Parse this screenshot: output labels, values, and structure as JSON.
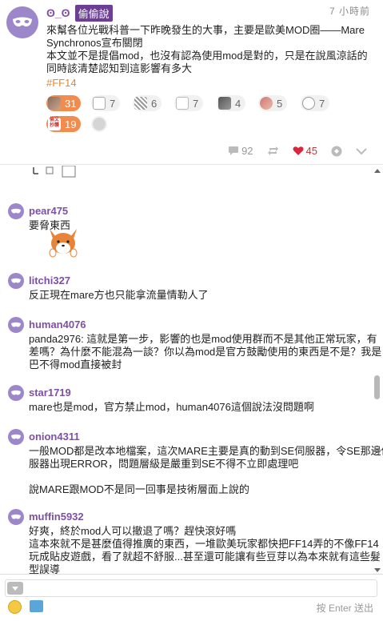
{
  "post": {
    "author_id": "ʘ_ʘ",
    "author_name": "偷偷說",
    "time": "7 小時前",
    "body_lines": [
      "來幫各位光戰科普一下昨晚發生的大事，主要是歐美MOD圈——Mare",
      "Synchronos宣布關閉",
      "本文並不是提倡mod，也沒有認為使用mod是對的，只是在說風涼話的",
      "同時該清楚認知到這影響有多大"
    ],
    "tag": "#FF14",
    "reactions": [
      {
        "count": "31",
        "icon": "reaction-sticker-1"
      },
      {
        "count": "7",
        "icon": "reaction-sticker-2"
      },
      {
        "count": "6",
        "icon": "reaction-sticker-3"
      },
      {
        "count": "7",
        "icon": "reaction-sticker-4"
      },
      {
        "count": "4",
        "icon": "reaction-sticker-5"
      },
      {
        "count": "5",
        "icon": "reaction-sticker-6"
      },
      {
        "count": "7",
        "icon": "reaction-sticker-7"
      },
      {
        "count": "19",
        "icon": "reaction-sticker-8"
      },
      {
        "count": "",
        "icon": "add-reaction-icon"
      }
    ],
    "reaction_sticker_text": "偷文\n抄襲",
    "actions": {
      "comments": "92",
      "likes": "45"
    }
  },
  "comments": [
    {
      "name": "pear475",
      "lines": [
        "要脅東西"
      ]
    },
    {
      "name": "litchi327",
      "lines": [
        "反正現在mare方也只能拿流量情勒人了"
      ]
    },
    {
      "name": "human4076",
      "lines": [
        "panda2976: 這就是第一步，影響的也是mod使用群而不是其他正常玩家，有",
        "差嗎？為什麼不能混為一談？你以為mod是官方鼓勵使用的東西是不是？我是",
        "巴不得mod直接被封"
      ]
    },
    {
      "name": "star1719",
      "lines": [
        "mare也是mod，官方禁止mod，human4076這個說法沒問題啊"
      ]
    },
    {
      "name": "onion4311",
      "lines": [
        "一般MOD都是改本地檔案，這次MARE主要是真的動到SE伺服器，令SE那邊伺",
        "服器出現ERROR，問題層級是嚴重到SE不得不立即處理吧",
        "",
        "說MARE跟MOD不是同一回事是技術層面上說的"
      ]
    },
    {
      "name": "muffin5932",
      "lines": [
        "好爽，終於mod人可以撤退了嗎？趕快滾好嗎",
        "這本來就不是甚麼值得推廣的東西，一堆歐美玩家都快把FF14弄的不像FF14",
        "玩成貼皮遊戲，看了就超不舒服...甚至還可能讓有些豆芽以為本來就有這些髮",
        "型誤導"
      ]
    }
  ],
  "input": {
    "send_hint": "按 Enter 送出"
  },
  "colors": {
    "accent_purple": "#7f4ea8",
    "reaction_active": "#f28c4e",
    "tag_orange": "#e08a2e",
    "like_red": "#c33"
  }
}
